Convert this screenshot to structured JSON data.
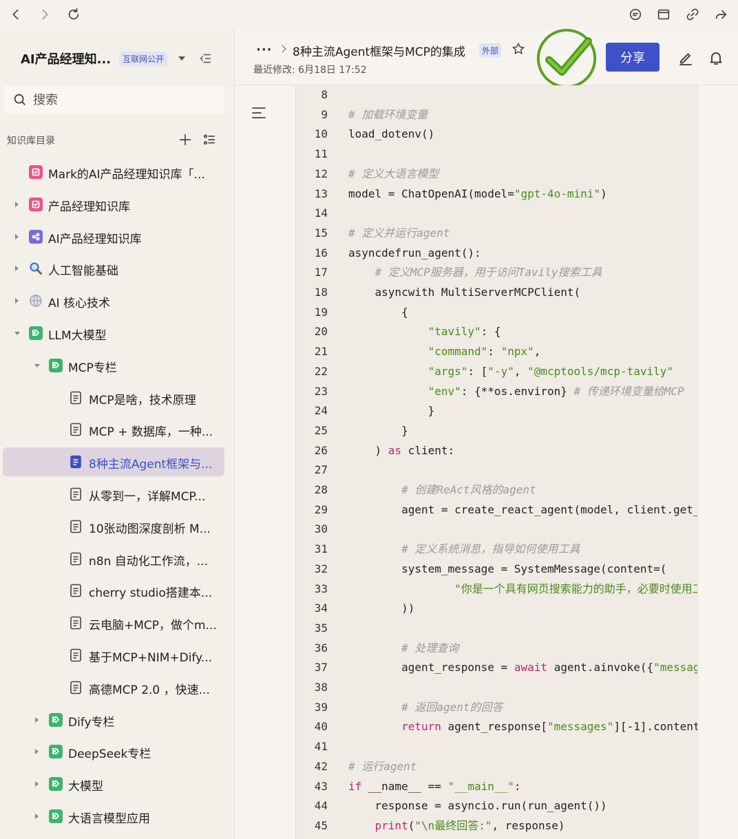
{
  "browser": {
    "buttons": [
      "back",
      "forward",
      "reload",
      "comment",
      "window",
      "link",
      "share-arrow"
    ]
  },
  "sidebar": {
    "kb_title": "AI产品经理知...",
    "kb_badge": "互联网公开",
    "search_placeholder": "搜索",
    "toc_label": "知识库目录",
    "items": [
      {
        "label": "Mark的AI产品经理知识库「...",
        "level": 0,
        "arrow": "none",
        "icon": "pink-doc"
      },
      {
        "label": "产品经理知识库",
        "level": 0,
        "arrow": "right",
        "icon": "pink-doc"
      },
      {
        "label": "AI产品经理知识库",
        "level": 0,
        "arrow": "right",
        "icon": "purple-share"
      },
      {
        "label": "人工智能基础",
        "level": 0,
        "arrow": "right",
        "icon": "magnifier"
      },
      {
        "label": "AI 核心技术",
        "level": 0,
        "arrow": "right",
        "icon": "globe"
      },
      {
        "label": "LLM大模型",
        "level": 0,
        "arrow": "down",
        "icon": "green-tag"
      },
      {
        "label": "MCP专栏",
        "level": 1,
        "arrow": "down",
        "icon": "green-tag"
      },
      {
        "label": "MCP是啥，技术原理",
        "level": 2,
        "arrow": "none",
        "icon": "doc"
      },
      {
        "label": "MCP + 数据库，一种...",
        "level": 2,
        "arrow": "none",
        "icon": "doc"
      },
      {
        "label": "8种主流Agent框架与...",
        "level": 2,
        "arrow": "none",
        "icon": "doc-active",
        "active": true
      },
      {
        "label": "从零到一，详解MCP...",
        "level": 2,
        "arrow": "none",
        "icon": "doc"
      },
      {
        "label": "10张动图深度剖析 M...",
        "level": 2,
        "arrow": "none",
        "icon": "doc"
      },
      {
        "label": "n8n 自动化工作流，...",
        "level": 2,
        "arrow": "none",
        "icon": "doc"
      },
      {
        "label": "cherry studio搭建本...",
        "level": 2,
        "arrow": "none",
        "icon": "doc"
      },
      {
        "label": "云电脑+MCP，做个m...",
        "level": 2,
        "arrow": "none",
        "icon": "doc"
      },
      {
        "label": "基于MCP+NIM+Dify...",
        "level": 2,
        "arrow": "none",
        "icon": "doc"
      },
      {
        "label": "高德MCP 2.0 ，快速...",
        "level": 2,
        "arrow": "none",
        "icon": "doc"
      },
      {
        "label": "Dify专栏",
        "level": 1,
        "arrow": "right",
        "icon": "green-tag"
      },
      {
        "label": "DeepSeek专栏",
        "level": 1,
        "arrow": "right",
        "icon": "green-tag"
      },
      {
        "label": "大模型",
        "level": 1,
        "arrow": "right",
        "icon": "green-tag"
      },
      {
        "label": "大语言模型应用",
        "level": 1,
        "arrow": "right",
        "icon": "green-tag"
      }
    ]
  },
  "header": {
    "dots": "···",
    "doc_title": "8种主流Agent框架与MCP的集成",
    "ext_badge": "外部",
    "modified": "最近修改: 6月18日 17:52",
    "share_label": "分享"
  },
  "colors": {
    "accent": "#3f51c8",
    "comment": "#9a9a9a",
    "string": "#4b8a1c",
    "keyword": "#b5287a",
    "check": "#5aa020"
  },
  "code": {
    "lines": [
      {
        "n": "8",
        "parts": []
      },
      {
        "n": "9",
        "parts": [
          {
            "t": "# 加载环境变量",
            "c": "cm"
          }
        ]
      },
      {
        "n": "10",
        "parts": [
          {
            "t": "load_dotenv()",
            "c": ""
          }
        ]
      },
      {
        "n": "11",
        "parts": []
      },
      {
        "n": "12",
        "parts": [
          {
            "t": "# 定义大语言模型",
            "c": "cm"
          }
        ]
      },
      {
        "n": "13",
        "parts": [
          {
            "t": "model = ChatOpenAI(model=",
            "c": ""
          },
          {
            "t": "\"gpt-4o-mini\"",
            "c": "st"
          },
          {
            "t": ")",
            "c": ""
          }
        ]
      },
      {
        "n": "14",
        "parts": []
      },
      {
        "n": "15",
        "parts": [
          {
            "t": "# 定义并运行agent",
            "c": "cm"
          }
        ]
      },
      {
        "n": "16",
        "parts": [
          {
            "t": "asyncdefrun_agent():",
            "c": ""
          }
        ]
      },
      {
        "n": "17",
        "parts": [
          {
            "t": "    # 定义MCP服务器，用于访问Tavily搜索工具",
            "c": "cm"
          }
        ]
      },
      {
        "n": "18",
        "parts": [
          {
            "t": "    asyncwith MultiServerMCPClient(",
            "c": ""
          }
        ]
      },
      {
        "n": "19",
        "parts": [
          {
            "t": "        {",
            "c": ""
          }
        ]
      },
      {
        "n": "20",
        "parts": [
          {
            "t": "            ",
            "c": ""
          },
          {
            "t": "\"tavily\"",
            "c": "st"
          },
          {
            "t": ": {",
            "c": ""
          }
        ]
      },
      {
        "n": "21",
        "parts": [
          {
            "t": "            ",
            "c": ""
          },
          {
            "t": "\"command\"",
            "c": "st"
          },
          {
            "t": ": ",
            "c": ""
          },
          {
            "t": "\"npx\"",
            "c": "st"
          },
          {
            "t": ",",
            "c": ""
          }
        ]
      },
      {
        "n": "22",
        "parts": [
          {
            "t": "            ",
            "c": ""
          },
          {
            "t": "\"args\"",
            "c": "st"
          },
          {
            "t": ": [",
            "c": ""
          },
          {
            "t": "\"-y\"",
            "c": "st"
          },
          {
            "t": ", ",
            "c": ""
          },
          {
            "t": "\"@mcptools/mcp-tavily\"",
            "c": "st"
          }
        ]
      },
      {
        "n": "23",
        "parts": [
          {
            "t": "            ",
            "c": ""
          },
          {
            "t": "\"env\"",
            "c": "st"
          },
          {
            "t": ": {**os.environ} ",
            "c": ""
          },
          {
            "t": "# 传递环境变量给MCP",
            "c": "cm"
          }
        ]
      },
      {
        "n": "24",
        "parts": [
          {
            "t": "            }",
            "c": ""
          }
        ]
      },
      {
        "n": "25",
        "parts": [
          {
            "t": "        }",
            "c": ""
          }
        ]
      },
      {
        "n": "26",
        "parts": [
          {
            "t": "    ) ",
            "c": ""
          },
          {
            "t": "as",
            "c": "kw"
          },
          {
            "t": " client:",
            "c": ""
          }
        ]
      },
      {
        "n": "27",
        "parts": []
      },
      {
        "n": "28",
        "parts": [
          {
            "t": "        # 创建ReAct风格的agent",
            "c": "cm"
          }
        ]
      },
      {
        "n": "29",
        "parts": [
          {
            "t": "        agent = create_react_agent(model, client.get_tools())",
            "c": ""
          }
        ]
      },
      {
        "n": "30",
        "parts": []
      },
      {
        "n": "31",
        "parts": [
          {
            "t": "        # 定义系统消息，指导如何使用工具",
            "c": "cm"
          }
        ]
      },
      {
        "n": "32",
        "parts": [
          {
            "t": "        system_message = SystemMessage(content=(",
            "c": ""
          }
        ]
      },
      {
        "n": "33",
        "parts": [
          {
            "t": "                ",
            "c": ""
          },
          {
            "t": "\"你是一个具有网页搜索能力的助手，必要时使用工具\"",
            "c": "st"
          }
        ]
      },
      {
        "n": "34",
        "parts": [
          {
            "t": "        ))",
            "c": ""
          }
        ]
      },
      {
        "n": "35",
        "parts": []
      },
      {
        "n": "36",
        "parts": [
          {
            "t": "        # 处理查询",
            "c": "cm"
          }
        ]
      },
      {
        "n": "37",
        "parts": [
          {
            "t": "        agent_response = ",
            "c": ""
          },
          {
            "t": "await",
            "c": "kw"
          },
          {
            "t": " agent.ainvoke({",
            "c": ""
          },
          {
            "t": "\"messages\"",
            "c": "st"
          }
        ]
      },
      {
        "n": "38",
        "parts": []
      },
      {
        "n": "39",
        "parts": [
          {
            "t": "        # 返回agent的回答",
            "c": "cm"
          }
        ]
      },
      {
        "n": "40",
        "parts": [
          {
            "t": "        ",
            "c": ""
          },
          {
            "t": "return",
            "c": "kw"
          },
          {
            "t": " agent_response[",
            "c": ""
          },
          {
            "t": "\"messages\"",
            "c": "st"
          },
          {
            "t": "][-1].content",
            "c": ""
          }
        ]
      },
      {
        "n": "41",
        "parts": []
      },
      {
        "n": "42",
        "parts": [
          {
            "t": "# 运行agent",
            "c": "cm"
          }
        ]
      },
      {
        "n": "43",
        "parts": [
          {
            "t": "if",
            "c": "kw"
          },
          {
            "t": " __name__ == ",
            "c": ""
          },
          {
            "t": "\"__main__\"",
            "c": "st"
          },
          {
            "t": ":",
            "c": ""
          }
        ]
      },
      {
        "n": "44",
        "parts": [
          {
            "t": "    response = asyncio.run(run_agent())",
            "c": ""
          }
        ]
      },
      {
        "n": "45",
        "parts": [
          {
            "t": "    ",
            "c": ""
          },
          {
            "t": "print",
            "c": "kw"
          },
          {
            "t": "(",
            "c": ""
          },
          {
            "t": "\"\\n最终回答:\"",
            "c": "st"
          },
          {
            "t": ", response)",
            "c": ""
          }
        ]
      }
    ]
  }
}
